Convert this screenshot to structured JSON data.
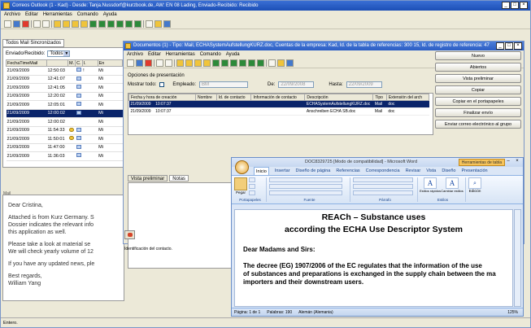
{
  "main_window": {
    "title": "Correos Outlook (1 - Kad) - Desde: Tanja.Nussdorf@kurzbook.de, AW: EN 08 Lading, Enviado-Recibido: Recibido",
    "menu": [
      "Archivo",
      "Editar",
      "Herramientas",
      "Comando",
      "Ayuda"
    ],
    "list_tab": "Todos Mail Sincronizados",
    "filter_label": "Enviado/Recibido:",
    "filter_value": "Todos",
    "columns": [
      "FechaTimeMail",
      "M.",
      "C.",
      "I.",
      "En"
    ],
    "rows": [
      {
        "date": "21/09/2009",
        "time": "12:50:03",
        "flag": "!",
        "to": "Mi"
      },
      {
        "date": "21/09/2009",
        "time": "12:41:07",
        "flag": "",
        "to": "Mi"
      },
      {
        "date": "21/09/2009",
        "time": "12:41:05",
        "flag": "",
        "to": "Mi"
      },
      {
        "date": "21/09/2009",
        "time": "12:20:02",
        "flag": "",
        "to": "Mi"
      },
      {
        "date": "21/09/2009",
        "time": "12:05:01",
        "flag": "",
        "to": "Mi"
      },
      {
        "date": "21/09/2009",
        "time": "12:00:02",
        "flag": "",
        "to": "Mi"
      },
      {
        "date": "21/09/2009",
        "time": "12:00:02",
        "flag": "",
        "to": "Mi"
      },
      {
        "date": "21/09/2009",
        "time": "11:54:33",
        "flag": "",
        "to": "Mi"
      },
      {
        "date": "21/09/2009",
        "time": "11:50:01",
        "flag": "",
        "to": "Mi"
      },
      {
        "date": "21/09/2009",
        "time": "11:47:00",
        "flag": "",
        "to": "Mi"
      },
      {
        "date": "21/09/2009",
        "time": "11:36:03",
        "flag": "",
        "to": "Mi"
      }
    ],
    "mail_label": "Mail",
    "mail_body": [
      "Dear Cristina,",
      "Attached is from Kurz Germany. S",
      "Dossier indicates the relevant info",
      "this application as well.",
      "Please take a look at material se",
      "We will check yearly volume of 12",
      "If you have any updated news, ple",
      "Best regards,",
      "William Yang"
    ],
    "status": "Entero."
  },
  "docs_window": {
    "title": "Documentos (1) - Tipo: Mail, ECHASystemAufstellungKURZ.doc, Cuentas de la empresa: Kad, Id. de la tabla de referencias: 300 15, Id. de registro de referencia: 47",
    "menu": [
      "Archivo",
      "Editar",
      "Herramientas",
      "Comando",
      "Ayuda"
    ],
    "presentation_label": "Opciones de presentación",
    "show_all_label": "Mostrar todo:",
    "employee_label": "Empleado:",
    "employee_value": "BM",
    "from_label": "De:",
    "from_value": "22/09/2008",
    "to_label": "Hasta:",
    "to_value": "22/09/2009",
    "columns": [
      "Fecha y hora de creación",
      "Nombre",
      "Id. de contacto",
      "Información de contacto",
      "Descripción",
      "Tipo",
      "Extensión del arch"
    ],
    "rows": [
      {
        "date": "21/09/2009",
        "time": "10:07:37",
        "desc": "ECHASystemAufstellungKURZ.doc",
        "type": "Mail",
        "ext": "doc"
      },
      {
        "date": "21/09/2009",
        "time": "10:07:37",
        "desc": "Anschreiben ECHA SB.doc",
        "type": "Mail",
        "ext": "doc"
      }
    ],
    "tabs": [
      "Vista preliminar",
      "Notas"
    ],
    "contact_id_label": "Identificación del contacto.",
    "buttons": [
      "Nuevo",
      "Abiertos",
      "Vista preliminar",
      "Copiar",
      "Copiar en el portapapeles",
      "Finalizar envío",
      "Enviar correo electrónico al grupo"
    ]
  },
  "word_window": {
    "title": "DOC8329725 [Modo de compatibilidad] - Microsoft Word",
    "table_tools": "Herramientas de tabla",
    "tabs": [
      "Inicio",
      "Insertar",
      "Diseño de página",
      "Referencias",
      "Correspondencia",
      "Revisar",
      "Vista",
      "Diseño",
      "Presentación"
    ],
    "groups": [
      "Portapapeles",
      "Fuente",
      "Párrafo",
      "Estilos",
      "Edición"
    ],
    "paste_label": "Pegar",
    "quick_styles_label": "Estilos rápidos",
    "change_styles_label": "Cambiar estilos",
    "edit_label": "Edición",
    "heading_line1": "REACh – Substance uses",
    "heading_line2": "according the ECHA Use Descriptor System",
    "salutation": "Dear Madams and Sirs:",
    "body": [
      "The decree (EG) 1907/2006 of the EC regulates that the information of the use",
      "of substances and preparations is exchanged in the supply chain between the ma",
      "importers and their downstream users."
    ],
    "status_page": "Página: 1 de 1",
    "status_words": "Palabras: 190",
    "status_lang": "Alemán (Alemania)",
    "zoom": "125%"
  },
  "colors": {
    "titlebar": "#1c4fb6",
    "selection": "#0a246a",
    "window_bg": "#ece9d8",
    "word_bg": "#dbe6f6"
  }
}
